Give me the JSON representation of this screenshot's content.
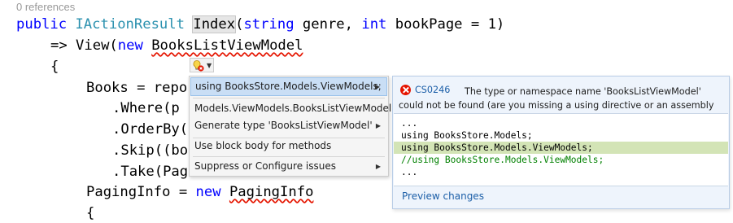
{
  "codelens": "0 references",
  "code": {
    "l1": {
      "kw_public": "public",
      "type_result": "IActionResult",
      "method": "Index",
      "p1": "(",
      "kw_string": "string",
      "p2": " genre, ",
      "kw_int": "int",
      "p3": " bookPage = 1)"
    },
    "l2": {
      "p1": "=> View(",
      "kw_new": "new",
      "type_vm": "BooksListViewModel"
    },
    "l3": "{",
    "l4": "Books = repo",
    "l5": ".Where(p",
    "l6": ".OrderBy(",
    "l7": ".Skip((bo",
    "l8": ".Take(Pag",
    "l9": {
      "p1": "PagingInfo = ",
      "kw_new": "new",
      "type_pi": "PagingInfo"
    },
    "l10": "{"
  },
  "quick_actions": {
    "items": [
      {
        "label": "using BooksStore.Models.ViewModels;",
        "has_submenu": true
      },
      {
        "label": "Models.ViewModels.BooksListViewModel",
        "has_submenu": false
      },
      {
        "label": "Generate type 'BooksListViewModel'",
        "has_submenu": true
      },
      {
        "label": "Use block body for methods",
        "has_submenu": false
      },
      {
        "label": "Suppress or Configure issues",
        "has_submenu": true
      }
    ]
  },
  "preview": {
    "error_code": "CS0246",
    "error_message": "The type or namespace name 'BooksListViewModel' could not be found (are you missing a using directive or an assembly reference?)",
    "diff_lines": [
      {
        "text": "...",
        "kind": "context"
      },
      {
        "text": "using BooksStore.Models;",
        "kind": "context"
      },
      {
        "text": "using BooksStore.Models.ViewModels;",
        "kind": "added"
      },
      {
        "text": "//using BooksStore.Models.ViewModels;",
        "kind": "comment"
      },
      {
        "text": "...",
        "kind": "context"
      }
    ],
    "link": "Preview changes"
  },
  "colors": {
    "keyword": "#0000ff",
    "type": "#2b91af",
    "error_squiggle": "#e51400",
    "menu_selected": "#c9def5",
    "preview_bg": "#eef4fc",
    "added_line": "#d3e4b6"
  },
  "icons": {
    "lightbulb": "lightbulb-error-icon",
    "error": "error-circle-icon",
    "submenu": "chevron-right-icon"
  }
}
